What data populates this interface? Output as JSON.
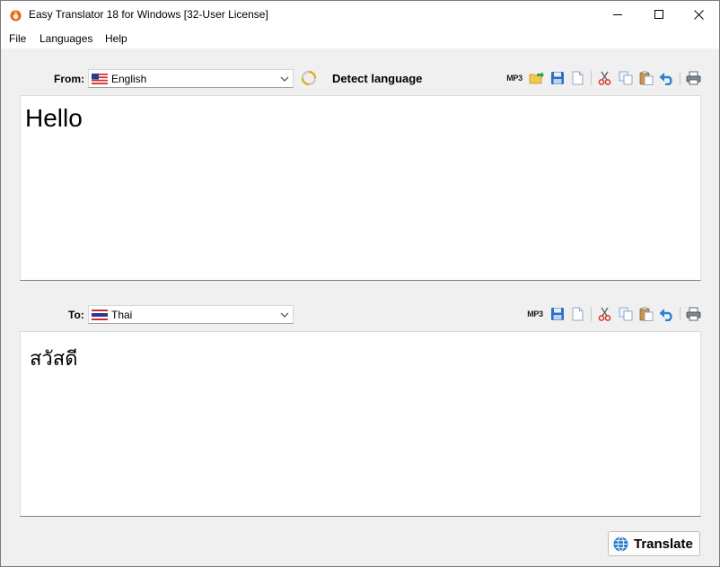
{
  "window": {
    "title": "Easy Translator 18 for Windows [32-User License]"
  },
  "menu": [
    "File",
    "Languages",
    "Help"
  ],
  "source": {
    "label": "From:",
    "language": "English",
    "detect_label": "Detect language",
    "text": "Hello"
  },
  "target": {
    "label": "To:",
    "language": "Thai",
    "text": "สวัสดี"
  },
  "toolbar": {
    "mp3_label": "MP3"
  },
  "translate_button": {
    "label": "Translate"
  },
  "colors": {
    "accent_blue": "#1f6fd1",
    "flag_red": "#d22a2a",
    "flag_blue": "#2a3a8c",
    "scissors_red": "#d43a2a"
  }
}
